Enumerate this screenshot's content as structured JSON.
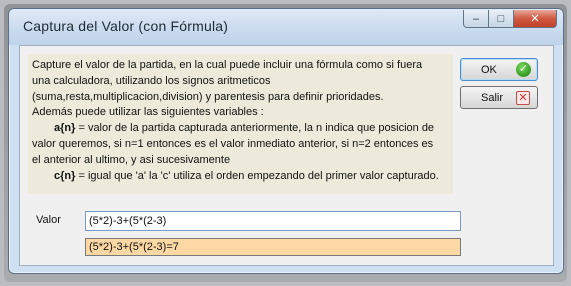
{
  "window": {
    "title": "Captura del Valor (con Fórmula)",
    "controls": {
      "minimize": "–",
      "maximize": "□",
      "close": "✕"
    }
  },
  "info": {
    "lines": [
      "Capture el valor de la partida, en la cual puede incluir una fórmula como si fuera",
      "una calculadora, utilizando los signos aritmeticos",
      "(suma,resta,multiplicacion,division) y parentesis para definir prioridades.",
      "Además puede utilizar las siguientes variables :"
    ],
    "var_a": {
      "name": "a{n}",
      "line1": " = valor de la partida capturada anteriormente, la n indica que posicion de",
      "line2": "valor queremos, si n=1 entonces es el valor inmediato anterior, si n=2 entonces es",
      "line3": "el anterior al ultimo, y asi sucesivamente"
    },
    "var_c": {
      "name": "c{n}",
      "text": " = igual que 'a' la 'c' utiliza el orden empezando del primer valor capturado."
    }
  },
  "buttons": {
    "ok": {
      "label": "OK",
      "icon": "checkmark-icon"
    },
    "salir": {
      "label": "Salir",
      "icon": "close-x-icon"
    }
  },
  "form": {
    "valor_label": "Valor",
    "valor_value": "(5*2)-3+(5*(2-3)",
    "result": "(5*2)-3+(5*(2-3)=7"
  },
  "colors": {
    "info_background": "#edeadb",
    "result_background": "#fcd9a4",
    "ok_icon": "#2f9a1f",
    "close_button": "#c2402a"
  }
}
